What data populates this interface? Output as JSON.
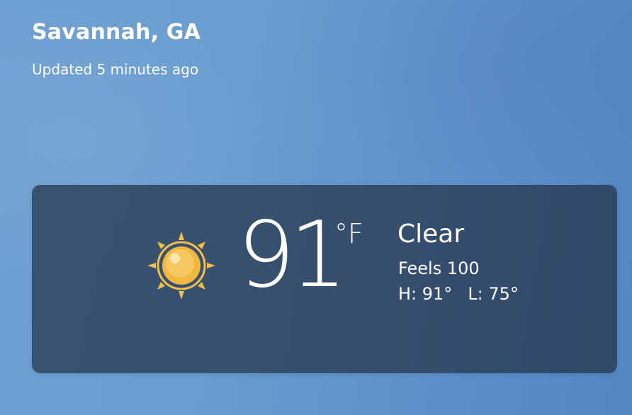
{
  "header": {
    "location": "Savannah, GA",
    "updated": "Updated 5 minutes ago"
  },
  "current": {
    "icon": "sun-icon",
    "temperature": "91",
    "unit": "°F",
    "condition": "Clear",
    "feels_like": "Feels 100",
    "high": "H: 91°",
    "low": "L: 75°"
  },
  "colors": {
    "background": "#6a9dd0",
    "card": "#354c68",
    "sun": "#f2bf4a",
    "text": "#ffffff"
  }
}
